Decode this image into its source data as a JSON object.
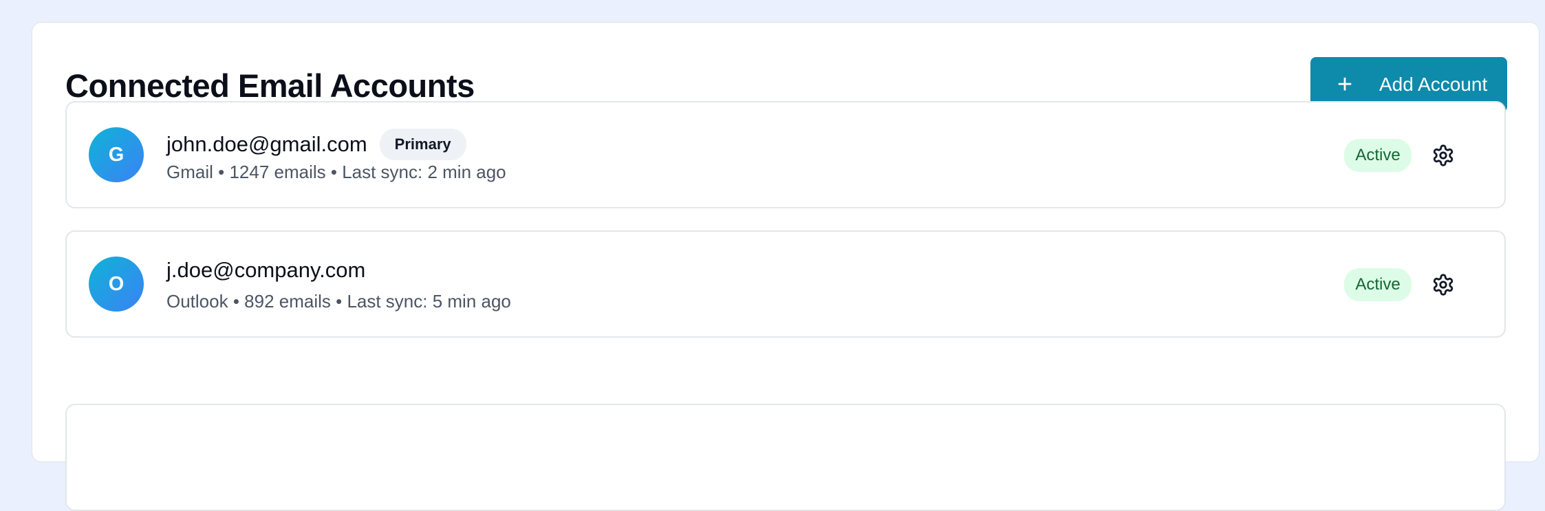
{
  "header": {
    "title": "Connected Email Accounts",
    "add_button_icon": "plus-icon",
    "add_button_label": "Add Account"
  },
  "accounts": [
    {
      "avatar_letter": "G",
      "email": "john.doe@gmail.com",
      "badge": "Primary",
      "meta": "Gmail • 1247 emails • Last sync: 2 min ago",
      "status": "Active",
      "settings_icon": "gear-icon"
    },
    {
      "avatar_letter": "O",
      "email": "j.doe@company.com",
      "badge": "",
      "meta": "Outlook • 892 emails • Last sync: 5 min ago",
      "status": "Active",
      "settings_icon": "gear-icon"
    }
  ],
  "colors": {
    "accent": "#0e8aab",
    "status_bg": "#dcfce7",
    "status_text": "#166534",
    "page_bg": "#eaf0fd"
  }
}
